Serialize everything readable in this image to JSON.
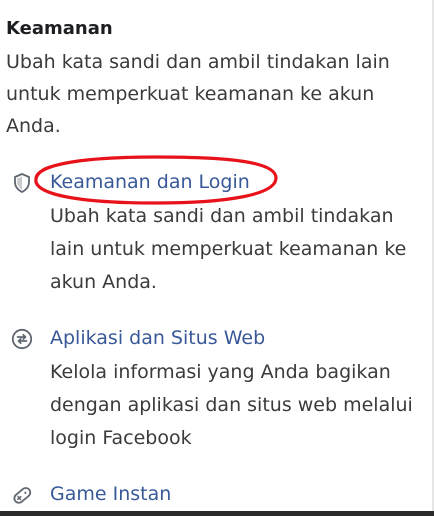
{
  "section": {
    "title": "Keamanan",
    "description": "Ubah kata sandi dan ambil tindakan lain untuk memperkuat keamanan ke akun Anda."
  },
  "items": [
    {
      "title": "Keamanan dan Login",
      "description": "Ubah kata sandi dan ambil tindakan lain untuk memperkuat keamanan ke akun Anda.",
      "icon": "shield-icon"
    },
    {
      "title": "Aplikasi dan Situs Web",
      "description": "Kelola informasi yang Anda bagikan dengan aplikasi dan situs web melalui login Facebook",
      "icon": "apps-arrows-icon"
    },
    {
      "title": "Game Instan",
      "icon": "game-controller-icon"
    }
  ],
  "colors": {
    "link": "#385898",
    "text": "#1c1e21",
    "secondary_text": "#3a3b3c",
    "annotation": "#e8121b"
  }
}
